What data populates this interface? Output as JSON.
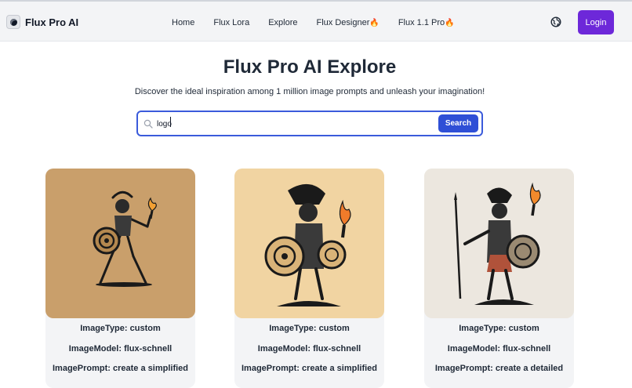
{
  "brand": {
    "name": "Flux Pro AI",
    "logo_icon": "flux-logo-icon"
  },
  "nav": {
    "items": [
      {
        "label": "Home",
        "fire": ""
      },
      {
        "label": "Flux Lora",
        "fire": ""
      },
      {
        "label": "Explore",
        "fire": ""
      },
      {
        "label": "Flux Designer",
        "fire": "🔥"
      },
      {
        "label": "Flux 1.1 Pro",
        "fire": "🔥"
      }
    ]
  },
  "header": {
    "language_icon": "language-globe-icon",
    "login_label": "Login"
  },
  "hero": {
    "title": "Flux Pro AI Explore",
    "subtitle": "Discover the ideal inspiration among 1 million image prompts and unleash your imagination!"
  },
  "search": {
    "value": "logo",
    "button_label": "Search",
    "icon": "search-icon"
  },
  "cards": [
    {
      "bg": "#c99f6b",
      "type_line": "ImageType: custom",
      "model_line": "ImageModel: flux-schnell",
      "prompt_line": "ImagePrompt: create a simplified"
    },
    {
      "bg": "#f1d4a2",
      "type_line": "ImageType: custom",
      "model_line": "ImageModel: flux-schnell",
      "prompt_line": "ImagePrompt: create a simplified"
    },
    {
      "bg": "#ece7df",
      "type_line": "ImageType: custom",
      "model_line": "ImageModel: flux-schnell",
      "prompt_line": "ImagePrompt: create a detailed"
    }
  ],
  "colors": {
    "accent": "#6d28d9",
    "search_border": "#3b5bdb",
    "search_button": "#2f4fd6"
  }
}
